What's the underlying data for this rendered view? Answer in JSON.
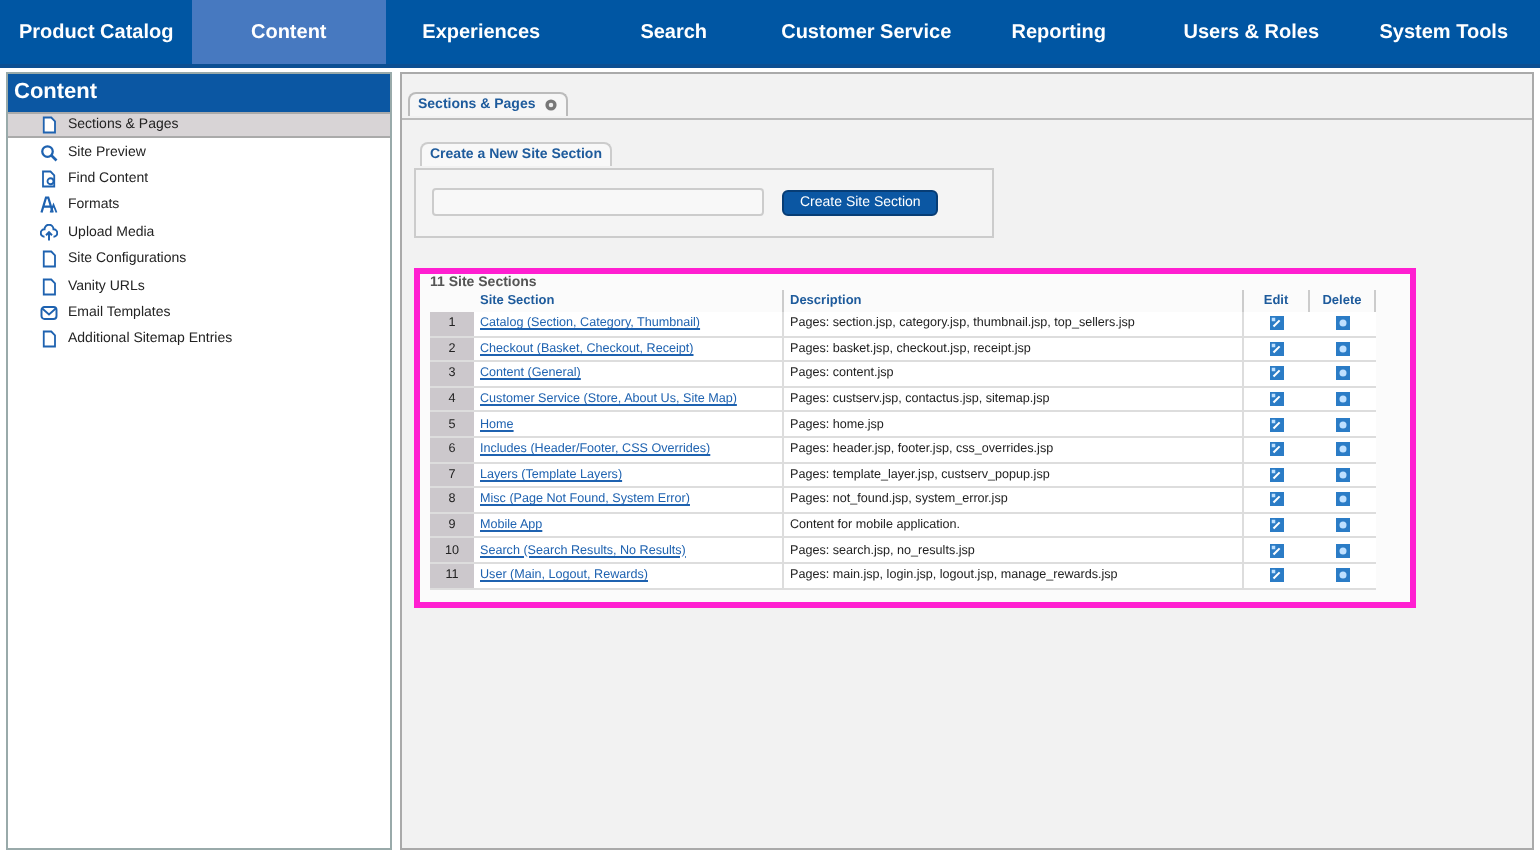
{
  "nav": [
    {
      "label": "Product Catalog",
      "selected": false
    },
    {
      "label": "Content",
      "selected": true
    },
    {
      "label": "Experiences",
      "selected": false
    },
    {
      "label": "Search",
      "selected": false
    },
    {
      "label": "Customer Service",
      "selected": false
    },
    {
      "label": "Reporting",
      "selected": false
    },
    {
      "label": "Users & Roles",
      "selected": false
    },
    {
      "label": "System Tools",
      "selected": false
    }
  ],
  "sidebar": {
    "title": "Content",
    "items": [
      {
        "label": "Sections & Pages",
        "selected": true
      },
      {
        "label": "Site Preview",
        "selected": false
      },
      {
        "label": "Find Content",
        "selected": false
      },
      {
        "label": "Formats",
        "selected": false
      },
      {
        "label": "Upload Media",
        "selected": false
      },
      {
        "label": "Site Configurations",
        "selected": false
      },
      {
        "label": "Vanity URLs",
        "selected": false
      },
      {
        "label": "Email Templates",
        "selected": false
      },
      {
        "label": "Additional Sitemap Entries",
        "selected": false
      }
    ]
  },
  "tab": {
    "label": "Sections & Pages"
  },
  "create": {
    "legend": "Create a New Site Section",
    "button": "Create Site Section"
  },
  "table": {
    "caption": "11 Site Sections",
    "columns": [
      "Site Section",
      "Description",
      "Edit",
      "Delete"
    ],
    "rows": [
      {
        "number": "1",
        "section": "Catalog (Section, Category, Thumbnail)",
        "description": "Pages: section.jsp, category.jsp, thumbnail.jsp, top_sellers.jsp"
      },
      {
        "number": "2",
        "section": "Checkout (Basket, Checkout, Receipt)",
        "description": "Pages: basket.jsp, checkout.jsp, receipt.jsp"
      },
      {
        "number": "3",
        "section": "Content (General)",
        "description": "Pages: content.jsp"
      },
      {
        "number": "4",
        "section": "Customer Service (Store, About Us, Site Map)",
        "description": "Pages: custserv.jsp, contactus.jsp, sitemap.jsp"
      },
      {
        "number": "5",
        "section": "Home",
        "description": "Pages: home.jsp"
      },
      {
        "number": "6",
        "section": "Includes (Header/Footer, CSS Overrides)",
        "description": "Pages: header.jsp, footer.jsp, css_overrides.jsp"
      },
      {
        "number": "7",
        "section": "Layers (Template Layers)",
        "description": "Pages: template_layer.jsp, custserv_popup.jsp"
      },
      {
        "number": "8",
        "section": "Misc (Page Not Found, System Error)",
        "description": "Pages: not_found.jsp, system_error.jsp"
      },
      {
        "number": "9",
        "section": "Mobile App",
        "description": "Content for mobile application."
      },
      {
        "number": "10",
        "section": "Search (Search Results, No Results)",
        "description": "Pages: search.jsp, no_results.jsp"
      },
      {
        "number": "11",
        "section": "User (Main, Logout, Rewards)",
        "description": "Pages: main.jsp, login.jsp, logout.jsp, manage_rewards.jsp"
      }
    ]
  }
}
